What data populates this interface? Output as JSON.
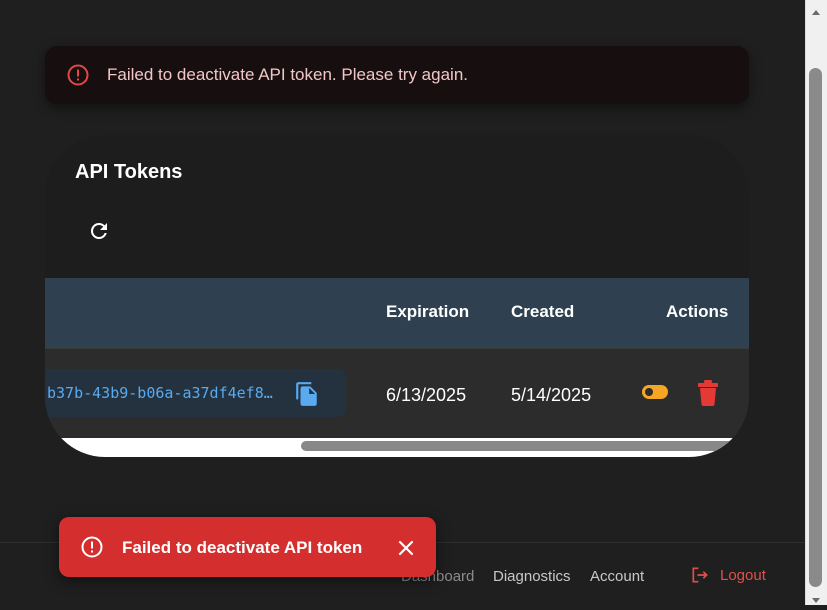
{
  "alert": {
    "message": "Failed to deactivate API token. Please try again.",
    "icon": "error-circle-icon",
    "color": "#e04848"
  },
  "card": {
    "title": "API Tokens",
    "refresh_icon": "refresh-icon",
    "columns": [
      "Expiration",
      "Created",
      "Actions"
    ],
    "rows": [
      {
        "token": "b37b-43b9-b06a-a37df4ef8…",
        "expiration": "6/13/2025",
        "created": "5/14/2025",
        "toggle_color": "#f5a623",
        "delete_color": "#e53935"
      }
    ]
  },
  "footer": {
    "links": [
      "Dashboard",
      "Diagnostics",
      "Account"
    ],
    "logout": "Logout",
    "logout_color": "#e0504a"
  },
  "toast": {
    "message": "Failed to deactivate API token",
    "background": "#d42e2e",
    "icon": "error-circle-icon",
    "close_icon": "close-icon"
  }
}
